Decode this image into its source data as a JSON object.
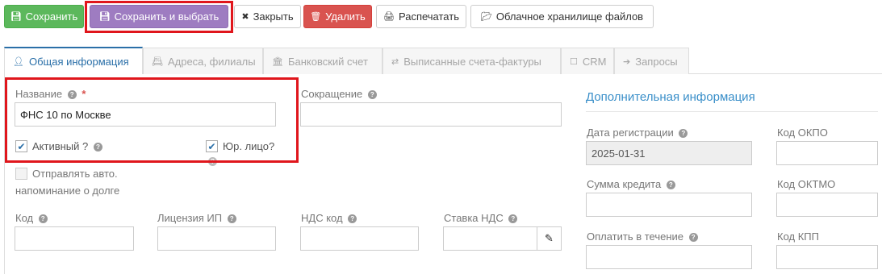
{
  "toolbar": {
    "save": "Сохранить",
    "save_and_select": "Сохранить и выбрать",
    "close": "Закрыть",
    "delete": "Удалить",
    "print": "Распечатать",
    "cloud_storage": "Облачное хранилище файлов"
  },
  "tabs": [
    {
      "label": "Общая информация",
      "icon": "id-card-icon",
      "active": true
    },
    {
      "label": "Адреса, филиалы",
      "icon": "address-card-icon",
      "active": false
    },
    {
      "label": "Банковский счет",
      "icon": "bank-icon",
      "active": false
    },
    {
      "label": "Выписанные счета-фактуры",
      "icon": "exchange-icon",
      "active": false
    },
    {
      "label": "CRM",
      "icon": "bookmark-icon",
      "active": false
    },
    {
      "label": "Запросы",
      "icon": "arrow-right-icon",
      "active": false
    }
  ],
  "form": {
    "name_label": "Название",
    "name_required_mark": "*",
    "name_value": "ФНС 10 по Москве",
    "abbreviation_label": "Сокращение",
    "abbreviation_value": "",
    "active_label": "Активный ?",
    "active_checked": true,
    "legal_entity_label": "Юр. лицо?",
    "legal_entity_checked": true,
    "auto_reminder_label_line1": "Отправлять авто.",
    "auto_reminder_label_line2": "напоминание о долге",
    "auto_reminder_checked": false,
    "code_label": "Код",
    "ip_license_label": "Лицензия ИП",
    "vat_code_label": "НДС код",
    "vat_rate_label": "Ставка НДС"
  },
  "additional": {
    "title": "Дополнительная информация",
    "registration_date_label": "Дата регистрации",
    "registration_date_value": "2025-01-31",
    "okpo_label": "Код ОКПО",
    "credit_sum_label": "Сумма кредита",
    "oktmo_label": "Код ОКТМО",
    "pay_within_label": "Оплатить в течение",
    "kpp_label": "Код КПП"
  },
  "colors": {
    "save_button": "#5cb85c",
    "save_select_button": "#9e7cc1",
    "delete_button": "#d9534f",
    "accent": "#2a6fa8",
    "highlight": "#e0161c"
  }
}
